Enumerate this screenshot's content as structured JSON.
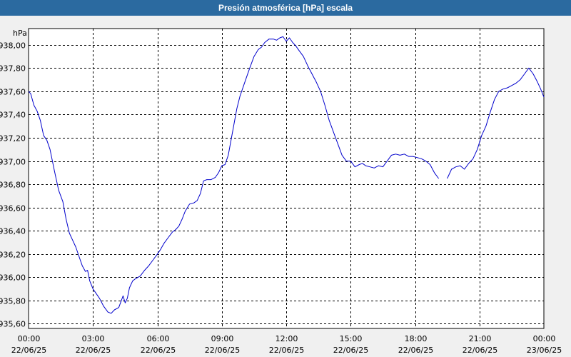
{
  "window": {
    "title": "Presión atmosférica [hPa] escala"
  },
  "chart_data": {
    "type": "line",
    "title": "Presión atmosférica [hPa] escala",
    "ylabel": "hPa",
    "xlabel": "",
    "ylim": [
      935.56,
      938.14
    ],
    "xlim": [
      0,
      24
    ],
    "grid": true,
    "y_ticks": [
      935.6,
      935.8,
      936.0,
      936.2,
      936.4,
      936.6,
      936.8,
      937.0,
      937.2,
      937.4,
      937.6,
      937.8,
      938.0
    ],
    "y_tick_labels": [
      "935,60",
      "935,80",
      "936,00",
      "936,20",
      "936,40",
      "936,60",
      "936,80",
      "937,00",
      "937,20",
      "937,40",
      "937,60",
      "937,80",
      "938,00"
    ],
    "x_ticks": [
      0,
      3,
      6,
      9,
      12,
      15,
      18,
      21,
      24
    ],
    "x_tick_labels": [
      {
        "time": "00:00",
        "date": "22/06/25"
      },
      {
        "time": "03:00",
        "date": "22/06/25"
      },
      {
        "time": "06:00",
        "date": "22/06/25"
      },
      {
        "time": "09:00",
        "date": "22/06/25"
      },
      {
        "time": "12:00",
        "date": "22/06/25"
      },
      {
        "time": "15:00",
        "date": "22/06/25"
      },
      {
        "time": "18:00",
        "date": "22/06/25"
      },
      {
        "time": "21:00",
        "date": "22/06/25"
      },
      {
        "time": "00:00",
        "date": "23/06/25"
      }
    ],
    "line_color": "#0000cc",
    "series": [
      {
        "segments": [
          {
            "x": [
              0.0,
              0.1,
              0.25,
              0.4,
              0.55,
              0.7,
              0.85,
              1.0,
              1.2,
              1.4,
              1.6,
              1.75,
              1.9,
              2.05,
              2.2,
              2.35,
              2.5,
              2.65,
              2.75,
              2.85,
              3.0,
              3.15,
              3.3,
              3.5,
              3.7,
              3.85,
              4.0,
              4.2,
              4.4,
              4.5,
              4.6,
              4.7,
              4.85,
              5.0,
              5.2,
              5.4,
              5.6,
              5.8,
              6.0,
              6.15,
              6.3,
              6.5,
              6.7,
              6.85,
              7.0,
              7.15,
              7.3,
              7.5,
              7.7,
              7.85,
              8.0,
              8.15,
              8.3,
              8.5,
              8.7,
              8.85,
              9.0,
              9.15,
              9.3,
              9.5,
              9.7,
              9.85,
              10.0,
              10.15,
              10.3,
              10.5,
              10.7,
              10.85,
              11.0,
              11.2,
              11.4,
              11.55,
              11.7,
              11.85,
              12.0,
              12.15,
              12.3,
              12.45,
              12.6,
              12.8,
              13.0,
              13.2,
              13.4,
              13.6,
              13.8,
              14.0,
              14.2,
              14.4,
              14.6,
              14.8,
              15.0,
              15.2,
              15.4,
              15.55,
              15.7,
              15.9,
              16.1,
              16.3,
              16.5,
              16.7,
              16.9,
              17.1,
              17.3,
              17.5,
              17.7,
              17.9,
              18.1,
              18.3,
              18.5,
              18.7,
              18.9,
              19.1
            ],
            "y": [
              937.6,
              937.58,
              937.48,
              937.43,
              937.35,
              937.22,
              937.18,
              937.1,
              936.92,
              936.75,
              936.65,
              936.5,
              936.38,
              936.32,
              936.26,
              936.18,
              936.1,
              936.05,
              936.06,
              935.97,
              935.9,
              935.86,
              935.82,
              935.75,
              935.7,
              935.69,
              935.72,
              935.74,
              935.84,
              935.78,
              935.82,
              935.91,
              935.97,
              935.99,
              936.01,
              936.06,
              936.1,
              936.15,
              936.2,
              936.24,
              936.29,
              936.34,
              936.39,
              936.41,
              936.44,
              936.5,
              936.57,
              936.63,
              936.64,
              936.66,
              936.72,
              936.83,
              936.84,
              936.84,
              936.86,
              936.9,
              936.96,
              936.97,
              937.05,
              937.25,
              937.45,
              937.56,
              937.64,
              937.72,
              937.8,
              937.9,
              937.96,
              937.98,
              938.02,
              938.05,
              938.05,
              938.04,
              938.06,
              938.07,
              938.03,
              938.06,
              938.02,
              937.99,
              937.95,
              937.9,
              937.82,
              937.75,
              937.68,
              937.6,
              937.48,
              937.35,
              937.25,
              937.15,
              937.05,
              937.0,
              937.0,
              936.95,
              936.97,
              936.98,
              936.96,
              936.95,
              936.94,
              936.96,
              936.95,
              937.0,
              937.05,
              937.06,
              937.05,
              937.06,
              937.04,
              937.04,
              937.03,
              937.02,
              937.0,
              936.97,
              936.9,
              936.85
            ]
          },
          {
            "x": [
              19.5,
              19.7,
              19.9,
              20.1,
              20.3,
              20.5,
              20.7,
              20.9,
              21.1,
              21.3,
              21.5,
              21.7,
              21.9,
              22.1,
              22.3,
              22.5,
              22.7,
              22.9,
              23.1,
              23.3,
              23.5,
              23.7,
              23.85,
              24.0
            ],
            "y": [
              936.85,
              936.93,
              936.95,
              936.96,
              936.93,
              936.98,
              937.02,
              937.1,
              937.22,
              937.3,
              937.42,
              937.53,
              937.6,
              937.62,
              937.63,
              937.65,
              937.67,
              937.7,
              937.75,
              937.8,
              937.75,
              937.68,
              937.62,
              937.55
            ]
          }
        ]
      }
    ]
  }
}
